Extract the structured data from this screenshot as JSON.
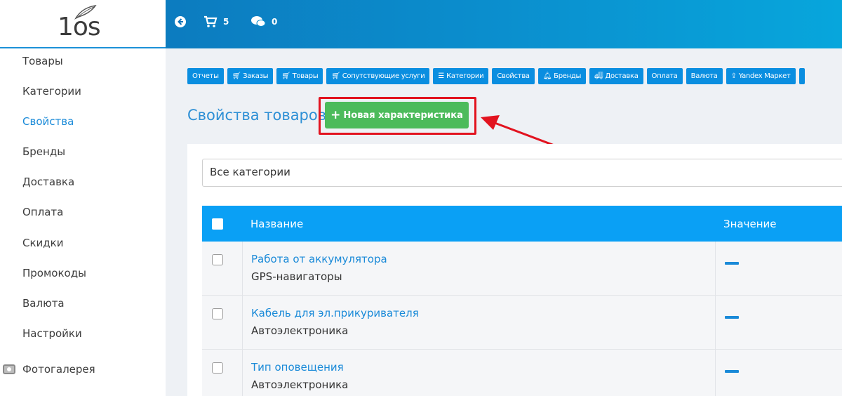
{
  "header": {
    "logo_text": "1os",
    "cart_count": "5",
    "messages_count": "0"
  },
  "sidebar": {
    "items": [
      {
        "label": "Товары"
      },
      {
        "label": "Категории"
      },
      {
        "label": "Свойства"
      },
      {
        "label": "Бренды"
      },
      {
        "label": "Доставка"
      },
      {
        "label": "Оплата"
      },
      {
        "label": "Скидки"
      },
      {
        "label": "Промокоды"
      },
      {
        "label": "Валюта"
      },
      {
        "label": "Настройки"
      }
    ],
    "gallery_label": "Фотогалерея"
  },
  "nav": {
    "buttons": [
      {
        "label": "Отчеты",
        "icon": ""
      },
      {
        "label": "Заказы",
        "icon": "cart-icon"
      },
      {
        "label": "Товары",
        "icon": "cart-icon"
      },
      {
        "label": "Сопутствующие услуги",
        "icon": "cart-icon"
      },
      {
        "label": "Категории",
        "icon": "list-icon"
      },
      {
        "label": "Свойства",
        "icon": ""
      },
      {
        "label": "Бренды",
        "icon": "bell-icon"
      },
      {
        "label": "Доставка",
        "icon": "truck-icon"
      },
      {
        "label": "Оплата",
        "icon": ""
      },
      {
        "label": "Валюта",
        "icon": ""
      },
      {
        "label": "Yandex Маркет",
        "icon": "upload-icon"
      }
    ]
  },
  "main": {
    "title": "Свойства товаров",
    "add_button_label": "Новая характеристика",
    "category_select": "Все категории",
    "table": {
      "headers": [
        "Название",
        "Значение"
      ],
      "rows": [
        {
          "name": "Работа от аккумулятора",
          "category": "GPS-навигаторы",
          "value": "—"
        },
        {
          "name": "Кабель для эл.прикуривателя",
          "category": "Автоэлектроника",
          "value": "—"
        },
        {
          "name": "Тип оповещения",
          "category": "Автоэлектроника",
          "value": "—"
        }
      ]
    }
  },
  "colors": {
    "accent": "#0a8ee0",
    "table_header": "#0aa0f5",
    "add_button": "#4cbb5b",
    "highlight": "#e2131f"
  }
}
